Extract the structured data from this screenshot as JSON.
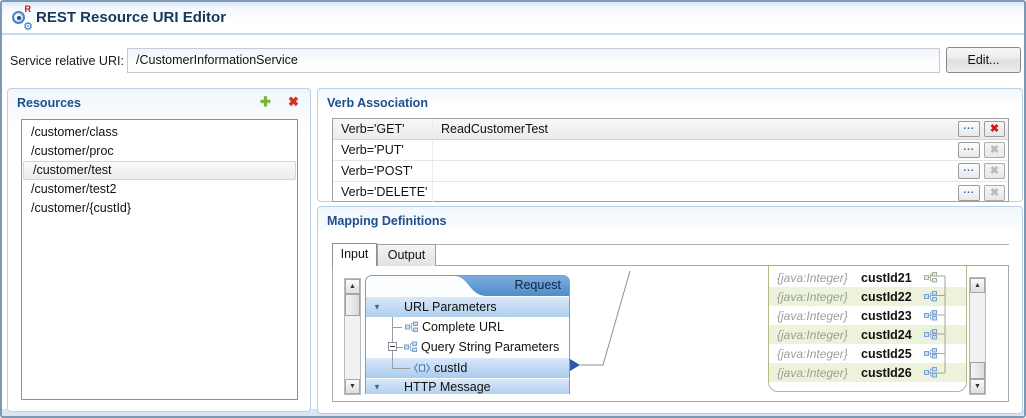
{
  "window": {
    "title": "REST Resource URI Editor"
  },
  "icons": {
    "add": "✚",
    "delete": "✖",
    "arrow_up": "▲",
    "arrow_down": "▼",
    "browse": "..."
  },
  "uri_bar": {
    "label": "Service relative URI:",
    "value": "/CustomerInformationService",
    "edit_button": "Edit..."
  },
  "resources": {
    "title": "Resources",
    "items": [
      "/customer/class",
      "/customer/proc",
      "/customer/test",
      "/customer/test2",
      "/customer/{custId}"
    ],
    "selected_index": 2
  },
  "verb_association": {
    "title": "Verb Association",
    "rows": [
      {
        "verb": "Verb='GET'",
        "process": "ReadCustomerTest",
        "delete_enabled": true
      },
      {
        "verb": "Verb='PUT'",
        "process": "",
        "delete_enabled": false
      },
      {
        "verb": "Verb='POST'",
        "process": "",
        "delete_enabled": false
      },
      {
        "verb": "Verb='DELETE'",
        "process": "",
        "delete_enabled": false
      }
    ]
  },
  "mapping": {
    "title": "Mapping Definitions",
    "tabs": [
      {
        "label": "Input",
        "active": true
      },
      {
        "label": "Output",
        "active": false
      }
    ],
    "request_tree": {
      "header": "Request",
      "nodes": [
        {
          "label": "URL Parameters"
        },
        {
          "label": "Complete URL"
        },
        {
          "label": "Query String Parameters"
        },
        {
          "label": "custId",
          "selected": true
        },
        {
          "label": "HTTP Message"
        }
      ]
    },
    "target_list": {
      "rows": [
        {
          "type_label": "{java:Integer}",
          "name": "custId21"
        },
        {
          "type_label": "{java:Integer}",
          "name": "custId22"
        },
        {
          "type_label": "{java:Integer}",
          "name": "custId23"
        },
        {
          "type_label": "{java:Integer}",
          "name": "custId24"
        },
        {
          "type_label": "{java:Integer}",
          "name": "custId25"
        },
        {
          "type_label": "{java:Integer}",
          "name": "custId26"
        }
      ]
    }
  },
  "colors": {
    "window_title": "#17365d",
    "panel_title": "#1f4e8c",
    "tree_row_blue": "#b0cfee",
    "target_row_alt": "#edf2da",
    "add_icon_green": "#79b235",
    "delete_icon_red": "#d03224",
    "mapping_anchor_blue": "#2b57b0"
  }
}
